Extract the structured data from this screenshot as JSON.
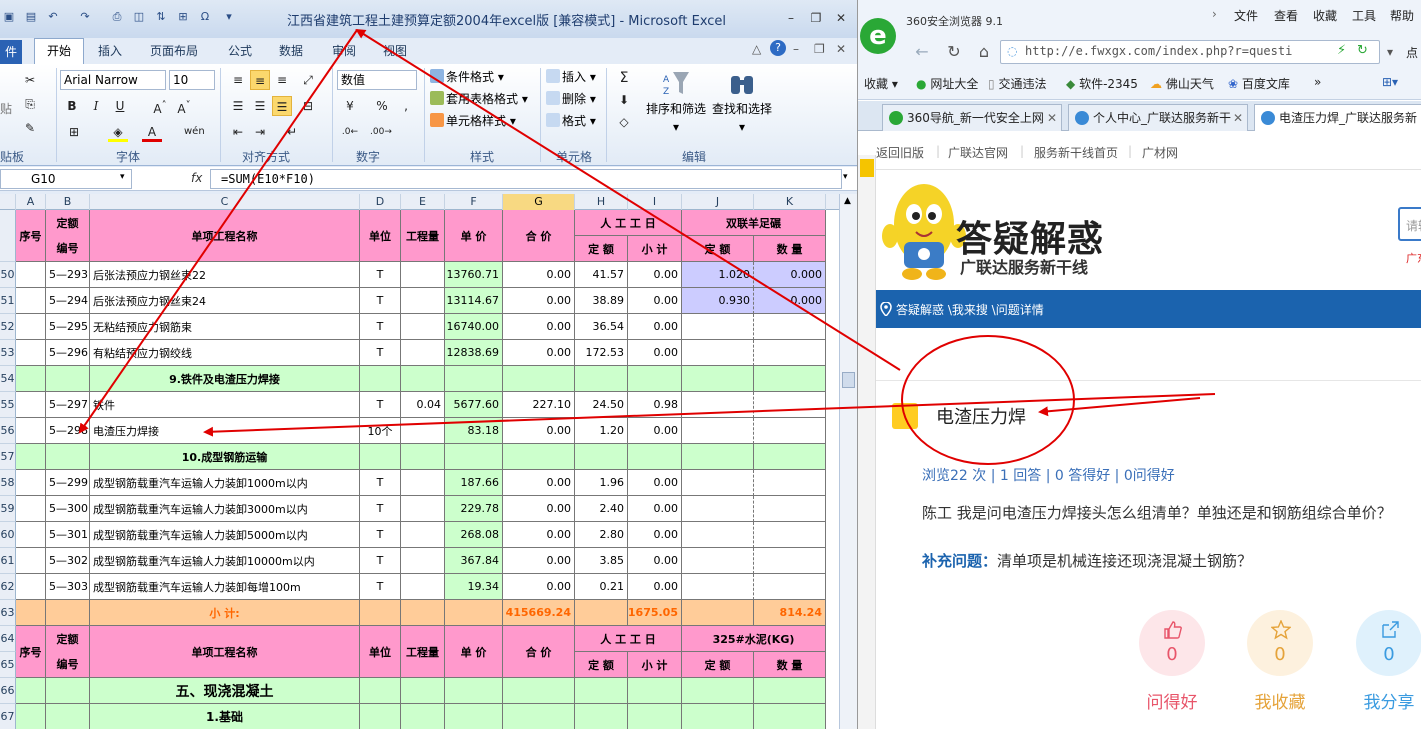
{
  "excel": {
    "title": "江西省建筑工程土建预算定额2004年excel版  [兼容模式] - Microsoft Excel",
    "qat_icons": [
      "save-icon",
      "open-icon",
      "undo-icon",
      "redo-icon",
      "print-icon",
      "print-preview-icon",
      "sort-icon",
      "omega-icon",
      "qat-more-icon"
    ],
    "tabs": {
      "file": "件",
      "home": "开始",
      "insert": "插入",
      "layout": "页面布局",
      "formulas": "公式",
      "data": "数据",
      "review": "审阅",
      "view": "视图"
    },
    "ribbon": {
      "paste": "贴",
      "clipboard_label": "贴板",
      "font_name": "Arial Narrow",
      "font_size": "10",
      "font_label": "字体",
      "align_label": "对齐方式",
      "number_format": "数值",
      "number_label": "数字",
      "cond_format": "条件格式",
      "table_format": "套用表格格式",
      "cell_style": "单元格样式",
      "styles_label": "样式",
      "insert": "插入",
      "delete": "删除",
      "format": "格式",
      "cells_label": "单元格",
      "sort_filter": "排序和筛选",
      "find_select": "查找和选择",
      "edit_label": "编辑"
    },
    "name_box": "G10",
    "fx": "fx",
    "formula": "=SUM(E10*F10)",
    "columns": [
      "A",
      "B",
      "C",
      "D",
      "E",
      "F",
      "G",
      "H",
      "I",
      "J",
      "K"
    ],
    "header1": {
      "seq": "序号",
      "code1": "定额",
      "code2": "编号",
      "name": "单项工程名称",
      "unit": "单位",
      "qty": "工程量",
      "price": "单 价",
      "total": "合 价",
      "labor": "人 工 工 日",
      "sub_q": "定 额",
      "sub_t": "小 计",
      "mat": "双联羊足碾",
      "mat_q": "定 额",
      "mat_n": "数 量"
    },
    "rows": [
      {
        "rn": "50",
        "b": "5—293",
        "c": "后张法预应力钢丝束22",
        "d": "T",
        "e": "",
        "f": "13760.71",
        "g": "0.00",
        "h": "41.57",
        "i": "0.00",
        "j": "1.020",
        "k": "0.000"
      },
      {
        "rn": "51",
        "b": "5—294",
        "c": "后张法预应力钢丝束24",
        "d": "T",
        "e": "",
        "f": "13114.67",
        "g": "0.00",
        "h": "38.89",
        "i": "0.00",
        "j": "0.930",
        "k": "0.000"
      },
      {
        "rn": "52",
        "b": "5—295",
        "c": "无粘结预应力钢筋束",
        "d": "T",
        "e": "",
        "f": "16740.00",
        "g": "0.00",
        "h": "36.54",
        "i": "0.00",
        "j": "",
        "k": ""
      },
      {
        "rn": "53",
        "b": "5—296",
        "c": "有粘结预应力钢绞线",
        "d": "T",
        "e": "",
        "f": "12838.69",
        "g": "0.00",
        "h": "172.53",
        "i": "0.00",
        "j": "",
        "k": ""
      },
      {
        "rn": "54",
        "section": "9.铁件及电渣压力焊接"
      },
      {
        "rn": "55",
        "b": "5—297",
        "c": "铁件",
        "d": "T",
        "e": "0.04",
        "f": "5677.60",
        "g": "227.10",
        "h": "24.50",
        "i": "0.98",
        "j": "",
        "k": ""
      },
      {
        "rn": "56",
        "b": "5—298",
        "c": "电渣压力焊接",
        "d": "10个",
        "e": "",
        "f": "83.18",
        "g": "0.00",
        "h": "1.20",
        "i": "0.00",
        "j": "",
        "k": ""
      },
      {
        "rn": "57",
        "section": "10.成型钢筋运输"
      },
      {
        "rn": "58",
        "b": "5—299",
        "c": "成型钢筋载重汽车运输人力装卸1000m以内",
        "d": "T",
        "e": "",
        "f": "187.66",
        "g": "0.00",
        "h": "1.96",
        "i": "0.00",
        "j": "",
        "k": ""
      },
      {
        "rn": "59",
        "b": "5—300",
        "c": "成型钢筋载重汽车运输人力装卸3000m以内",
        "d": "T",
        "e": "",
        "f": "229.78",
        "g": "0.00",
        "h": "2.40",
        "i": "0.00",
        "j": "",
        "k": ""
      },
      {
        "rn": "60",
        "b": "5—301",
        "c": "成型钢筋载重汽车运输人力装卸5000m以内",
        "d": "T",
        "e": "",
        "f": "268.08",
        "g": "0.00",
        "h": "2.80",
        "i": "0.00",
        "j": "",
        "k": ""
      },
      {
        "rn": "61",
        "b": "5—302",
        "c": "成型钢筋载重汽车运输人力装卸10000m以内",
        "d": "T",
        "e": "",
        "f": "367.84",
        "g": "0.00",
        "h": "3.85",
        "i": "0.00",
        "j": "",
        "k": ""
      },
      {
        "rn": "62",
        "b": "5—303",
        "c": "成型钢筋载重汽车运输人力装卸每增100m",
        "d": "T",
        "e": "",
        "f": "19.34",
        "g": "0.00",
        "h": "0.21",
        "i": "0.00",
        "j": "",
        "k": ""
      }
    ],
    "subtotal": {
      "rn": "63",
      "label": "小    计:",
      "g": "415669.24",
      "i": "1675.05",
      "k": "814.24"
    },
    "header2": {
      "rn1": "64",
      "rn2": "65",
      "seq": "序号",
      "code1": "定额",
      "code2": "编号",
      "name": "单项工程名称",
      "unit": "单位",
      "qty": "工程量",
      "price": "单 价",
      "total": "合 价",
      "labor": "人 工 工 日",
      "sub_q": "定 额",
      "sub_t": "小 计",
      "mat": "325#水泥(KG)",
      "mat_q": "定 额",
      "mat_n": "数 量"
    },
    "section5": {
      "rn": "66",
      "label": "五、现浇混凝土"
    },
    "section6": {
      "rn": "67",
      "label": "1.基础"
    }
  },
  "browser": {
    "name": "360安全浏览器 9.1",
    "menu": [
      "文件",
      "查看",
      "收藏",
      "工具",
      "帮助"
    ],
    "url": "http://e.fwxgx.com/index.php?r=questi",
    "point": "点",
    "favorites": [
      "收藏",
      "网址大全",
      "交通违法",
      "软件-2345",
      "佛山天气",
      "百度文库",
      "»"
    ],
    "tabs": [
      "360导航_新一代安全上网",
      "个人中心_广联达服务新干",
      "电渣压力焊_广联达服务新"
    ],
    "sitenav": [
      "返回旧版",
      "|",
      "广联达官网",
      "|",
      "服务新干线首页",
      "|",
      "广材网"
    ],
    "banner_title": "答疑解惑",
    "banner_sub": "广联达服务新干线",
    "search_placeholder": "请输入",
    "region": "广东省",
    "breadcrumb": "答疑解惑 \\我来搜 \\问题详情",
    "q_title": "电渣压力焊",
    "stats": "浏览22 次 | 1 回答 | 0 答得好 | 0问得好",
    "question": "陈工 我是问电渣压力焊接头怎么组清单？单独还是和钢筋组综合单价？",
    "suppl_label": "补充问题：",
    "suppl_text": "清单项是机械连接还现浇混凝土钢筋？",
    "actions": [
      {
        "count": "0",
        "label": "问得好",
        "color": "#e8556a",
        "bg": "#fde6e9"
      },
      {
        "count": "0",
        "label": "我收藏",
        "color": "#e5a33a",
        "bg": "#fdf1de"
      },
      {
        "count": "0",
        "label": "我分享",
        "color": "#3a9be0",
        "bg": "#dff1fc"
      }
    ]
  },
  "annotation_color": "#e00000"
}
